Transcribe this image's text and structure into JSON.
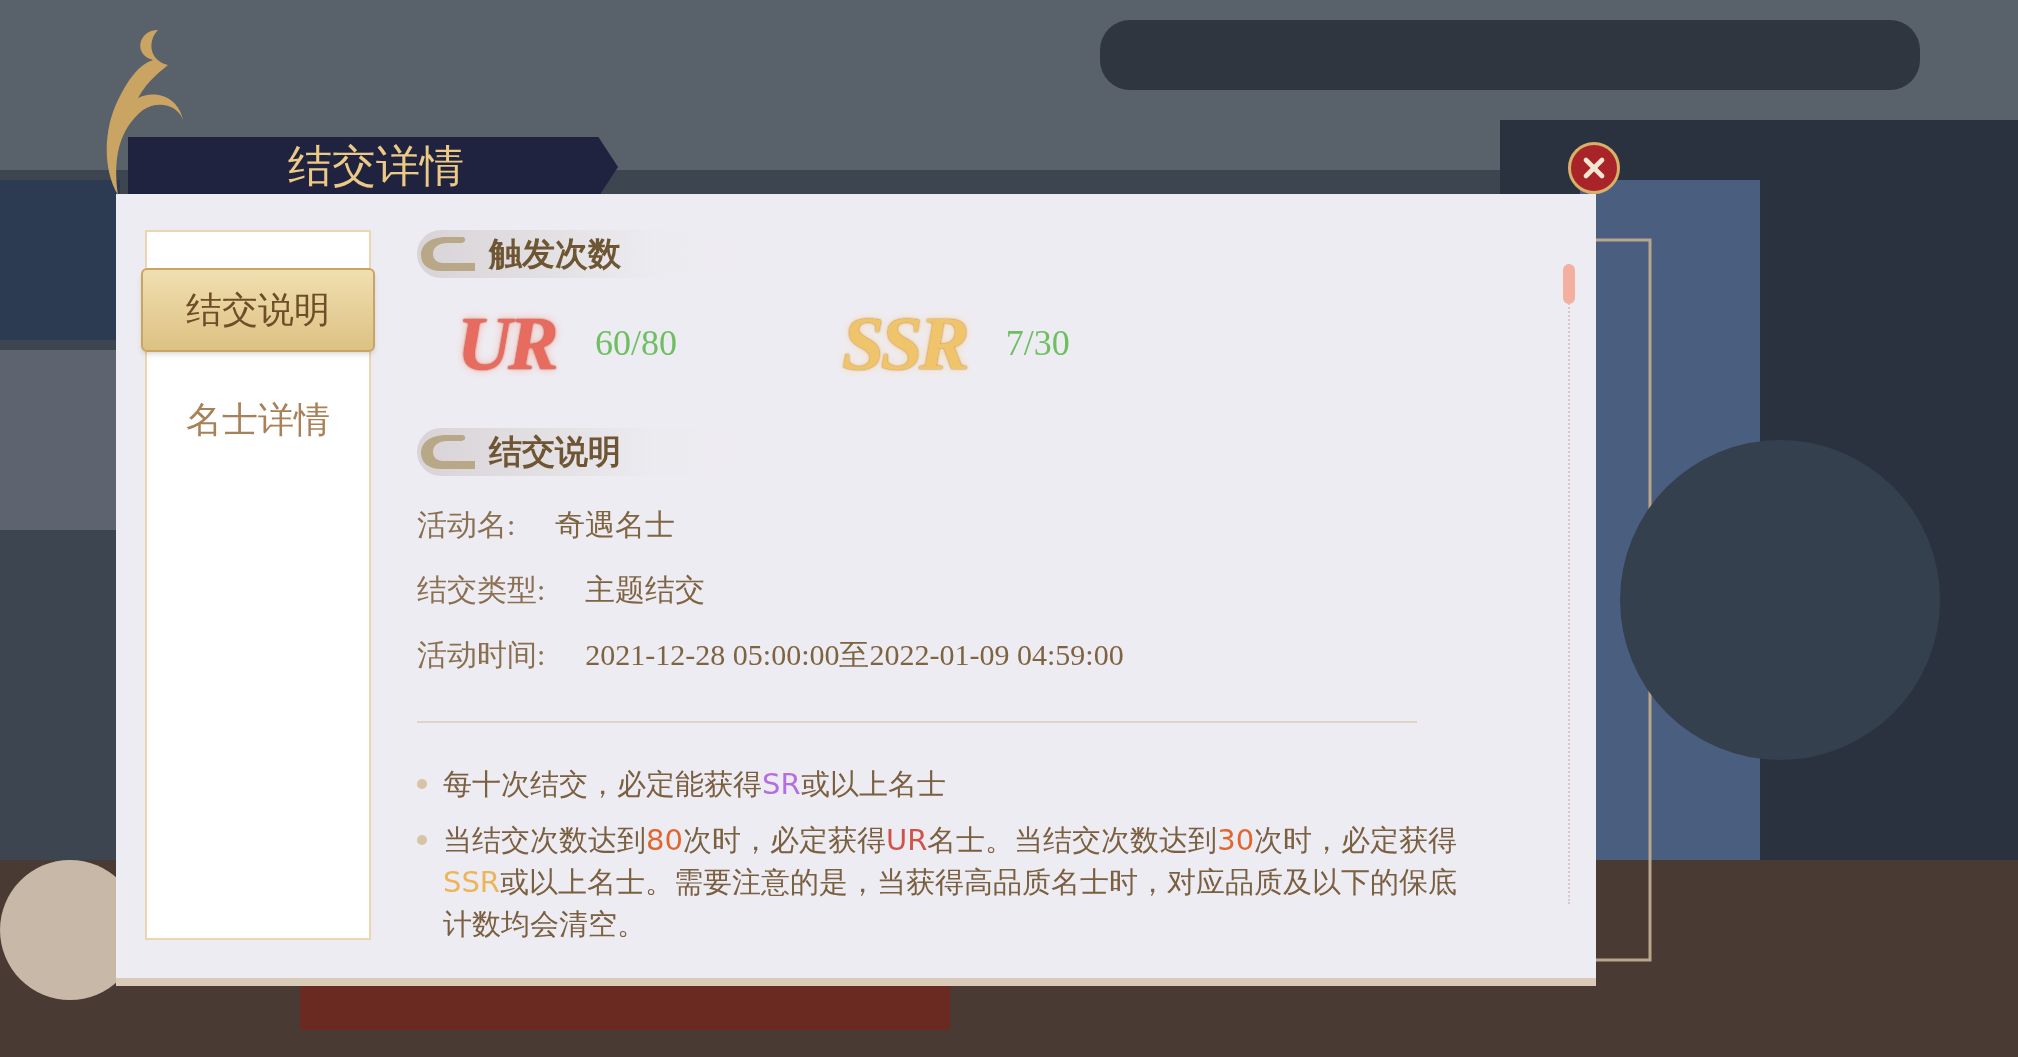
{
  "dialog": {
    "title": "结交详情"
  },
  "tabs": [
    {
      "label": "结交说明",
      "selected": true
    },
    {
      "label": "名士详情",
      "selected": false
    }
  ],
  "trigger_section": {
    "heading": "触发次数",
    "counters": [
      {
        "kind": "ur",
        "badge": "UR",
        "count": "60/80"
      },
      {
        "kind": "ssr",
        "badge": "SSR",
        "count": "7/30"
      }
    ]
  },
  "info_section": {
    "heading": "结交说明",
    "fields": [
      {
        "label": "活动名:",
        "value": "奇遇名士"
      },
      {
        "label": "结交类型:",
        "value": "主题结交"
      },
      {
        "label": "活动时间:",
        "value": "2021-12-28 05:00:00至2022-01-09 04:59:00"
      }
    ]
  },
  "rules": [
    {
      "segments": [
        {
          "text": "每十次结交，必定能获得"
        },
        {
          "text": "SR",
          "kind": "sr"
        },
        {
          "text": "或以上名士"
        }
      ]
    },
    {
      "segments": [
        {
          "text": "当结交次数达到"
        },
        {
          "text": "80",
          "kind": "number"
        },
        {
          "text": "次时，必定获得"
        },
        {
          "text": "UR",
          "kind": "ur"
        },
        {
          "text": "名士。当结交次数达到"
        },
        {
          "text": "30",
          "kind": "number"
        },
        {
          "text": "次时，必定获得"
        },
        {
          "text": "SSR",
          "kind": "ssr"
        },
        {
          "text": "或以上名士。需要注意的是，当获得高品质名士时，对应品质及以下的保底计数均会清空。"
        }
      ]
    }
  ]
}
